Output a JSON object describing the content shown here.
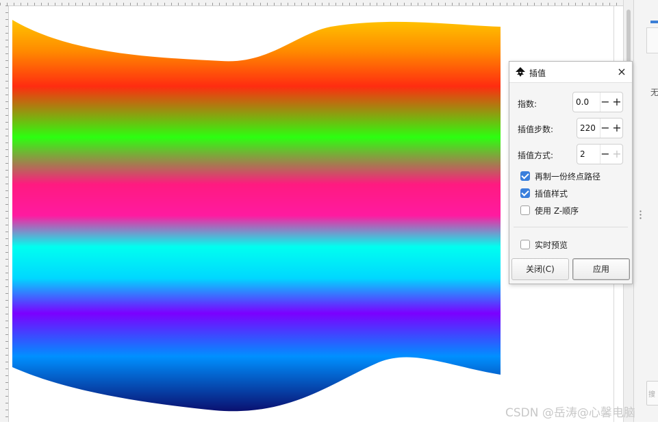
{
  "dialog": {
    "title": "插值",
    "close_icon": "close-icon",
    "exponent": {
      "label": "指数:",
      "value": "0.0"
    },
    "steps": {
      "label": "插值步数:",
      "value": "220"
    },
    "method": {
      "label": "插值方式:",
      "value": "2"
    },
    "spin_minus": "−",
    "spin_plus": "+",
    "checkboxes": [
      {
        "label": "再制一份终点路径",
        "checked": true
      },
      {
        "label": "插值样式",
        "checked": true
      },
      {
        "label": "使用 Z-顺序",
        "checked": false
      },
      {
        "label": "实时预览",
        "checked": false
      }
    ],
    "close_button": "关闭(C)",
    "apply_button": "应用"
  },
  "side_panel": {
    "text": "无",
    "box_text": "搜"
  },
  "watermark": "CSDN @岳涛@心馨电脑",
  "colors": {
    "gradient_stops": [
      "#ffc400",
      "#ff5a00",
      "#ff2c10",
      "#2cff10",
      "#ff2cd0",
      "#ff1a80",
      "#00fff0",
      "#00e0ff",
      "#8a00ff",
      "#7b00ff",
      "#0090ff",
      "#0a1a80"
    ],
    "accent": "#3a7fdc"
  }
}
